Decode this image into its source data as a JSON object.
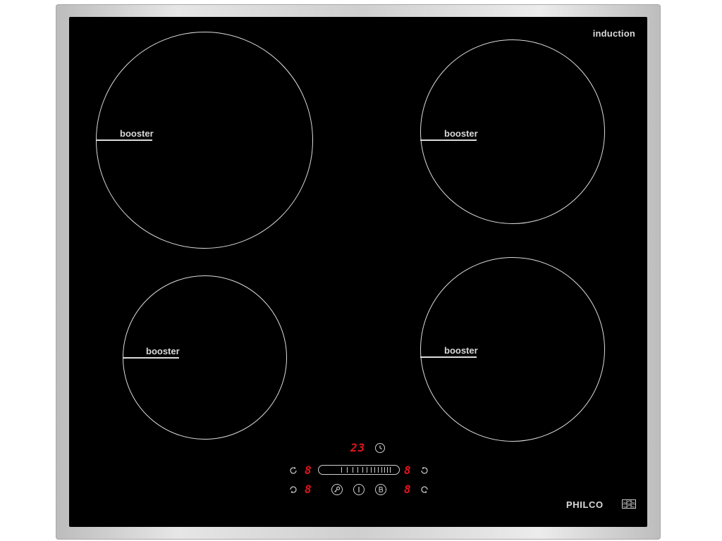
{
  "hob": {
    "brand_text": "induction",
    "manufacturer": "PHILCO",
    "zones": [
      {
        "id": "front-left",
        "booster_label": "booster"
      },
      {
        "id": "rear-right",
        "booster_label": "booster"
      },
      {
        "id": "rear-left",
        "booster_label": "booster"
      },
      {
        "id": "front-right",
        "booster_label": "booster"
      }
    ],
    "controls": {
      "timer_display": "23",
      "level_left_top": "8",
      "level_left_bottom": "8",
      "level_right_top": "8",
      "level_right_bottom": "8",
      "icons": {
        "timer": "clock-icon",
        "power": "power-icon",
        "lock": "key-icon",
        "boost": "boost-b-icon",
        "zone_select_left_top": "zone-select-icon",
        "zone_select_left_bottom": "zone-select-icon",
        "zone_select_right_top": "zone-select-icon",
        "zone_select_right_bottom": "zone-select-icon"
      }
    }
  }
}
